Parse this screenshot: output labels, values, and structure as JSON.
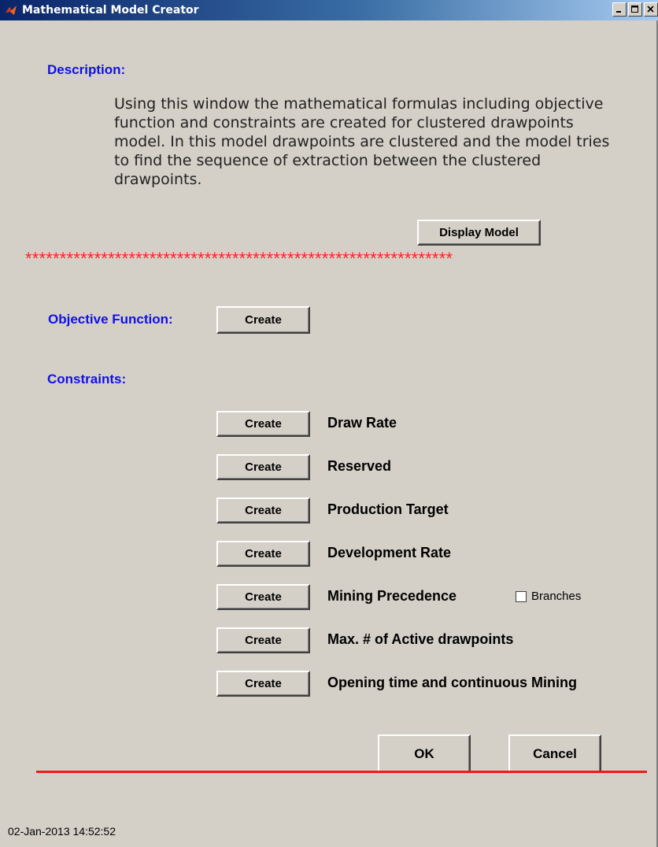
{
  "window": {
    "title": "Mathematical Model Creator",
    "buttons": [
      "minimize",
      "maximize",
      "close"
    ]
  },
  "description": {
    "label": "Description:",
    "text": "Using this window the mathematical formulas including objective function and constraints are created for clustered drawpoints model. In this model drawpoints are clustered and the model tries to find the sequence of extraction between the clustered drawpoints."
  },
  "display_model_button": "Display Model",
  "separator": "**************************************************************",
  "objective": {
    "label": "Objective Function:",
    "button": "Create"
  },
  "constraints": {
    "label": "Constraints:",
    "items": [
      {
        "button": "Create",
        "label": "Draw Rate"
      },
      {
        "button": "Create",
        "label": "Reserved"
      },
      {
        "button": "Create",
        "label": "Production Target"
      },
      {
        "button": "Create",
        "label": "Development Rate"
      },
      {
        "button": "Create",
        "label": "Mining Precedence"
      },
      {
        "button": "Create",
        "label": "Max. # of Active drawpoints"
      },
      {
        "button": "Create",
        "label": "Opening time and continuous Mining"
      }
    ],
    "branches_checkbox": {
      "label": "Branches",
      "checked": false
    }
  },
  "ok_button": "OK",
  "cancel_button": "Cancel",
  "status_timestamp": "02-Jan-2013 14:52:52",
  "colors": {
    "label_blue": "#1010e8",
    "separator_red": "#ff2020",
    "background": "#d4d0c8"
  }
}
